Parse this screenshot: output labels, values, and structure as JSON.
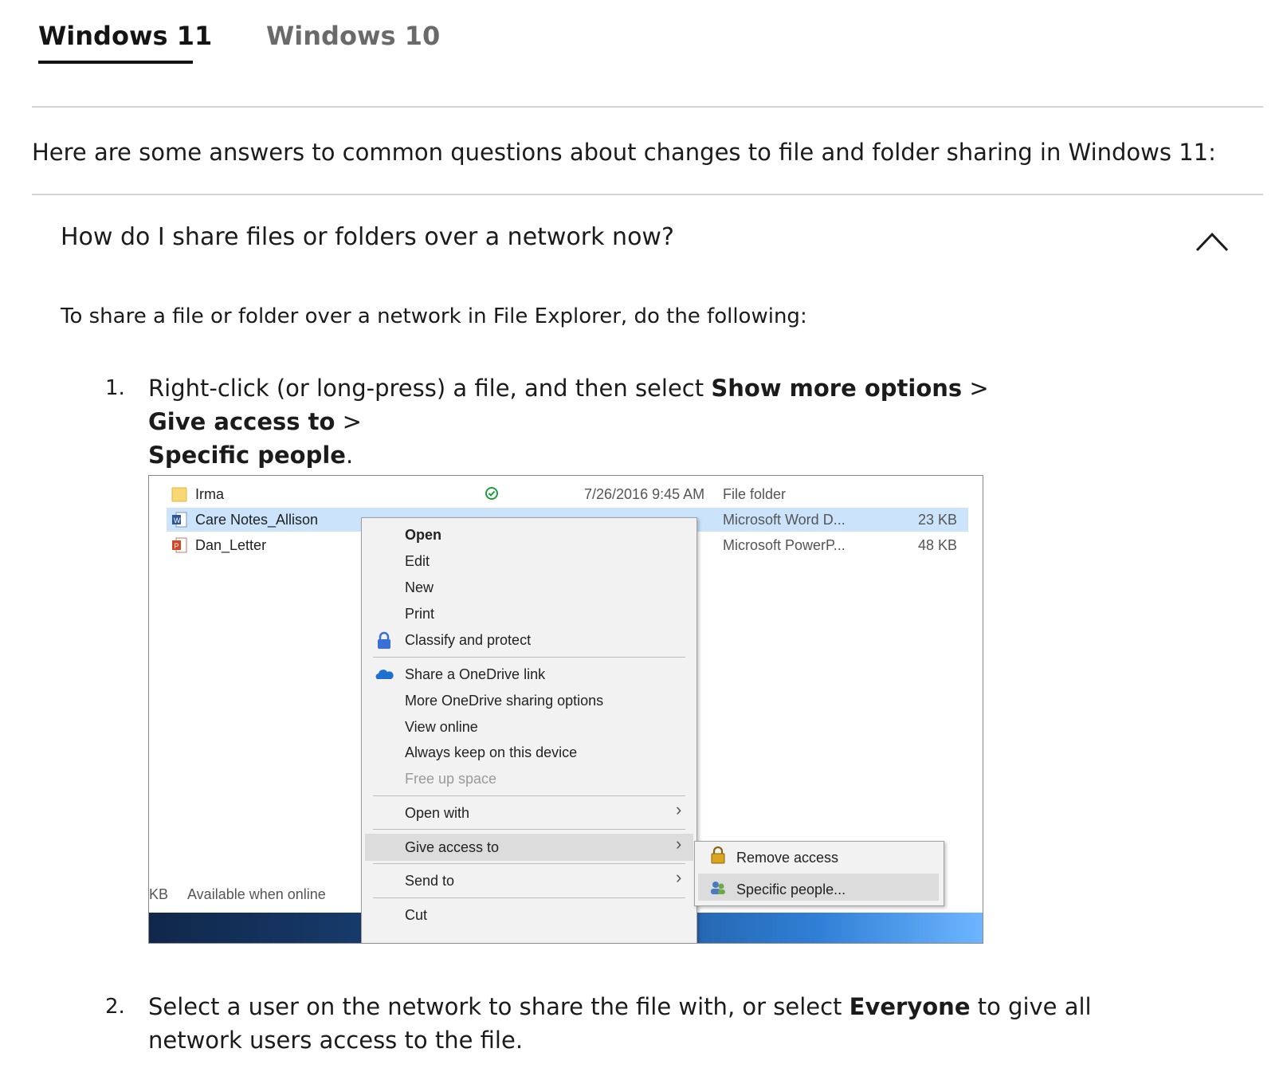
{
  "tabs": [
    {
      "label": "Windows 11",
      "active": true
    },
    {
      "label": "Windows 10",
      "active": false
    }
  ],
  "intro": "Here are some answers to common questions about changes to file and folder sharing in Windows 11:",
  "faq": {
    "question": "How do I share files or folders over a network now?",
    "expanded": true,
    "paragraph": "To share a file or folder over a network in File Explorer, do the following:"
  },
  "steps": [
    {
      "number": "1.",
      "parts": [
        "Right-click (or long-press) a file, and then select ",
        "Show more options",
        " > ",
        "Give access to",
        " > ",
        "Specific people",
        "."
      ]
    },
    {
      "number": "2.",
      "parts": [
        "Select a user on the network to share the file with, or select ",
        "Everyone",
        " to give all network users access to the file."
      ]
    }
  ],
  "screenshot": {
    "files": [
      {
        "name": "Irma",
        "date": "7/26/2016 9:45 AM",
        "type": "File folder",
        "size": "",
        "icon": "folder-icon",
        "status": "synced-check-icon"
      },
      {
        "name": "Care Notes_Allison",
        "date": "",
        "type": "Microsoft Word D...",
        "size": "23 KB",
        "icon": "word-doc-icon",
        "selected": true
      },
      {
        "name": "Dan_Letter",
        "date": "",
        "type": "Microsoft PowerP...",
        "size": "48 KB",
        "icon": "powerpoint-icon"
      }
    ],
    "status_kb": "KB",
    "status_available": "Available when online",
    "context_menu": {
      "items": {
        "open": "Open",
        "edit": "Edit",
        "new": "New",
        "print": "Print",
        "classify": "Classify and protect",
        "share_link": "Share a OneDrive link",
        "more_sharing": "More OneDrive sharing options",
        "view_online": "View online",
        "always_keep": "Always keep on this device",
        "free_up": "Free up space",
        "open_with": "Open with",
        "give_access": "Give access to",
        "send_to": "Send to",
        "cut": "Cut"
      },
      "submenu": {
        "remove_access": "Remove access",
        "specific_people": "Specific people..."
      }
    }
  },
  "colors": {
    "selected_row": "#cce4fb",
    "menu_bg": "#f2f2f2",
    "menu_highlight": "#dcdcdc",
    "divider": "#d4d4d4"
  }
}
